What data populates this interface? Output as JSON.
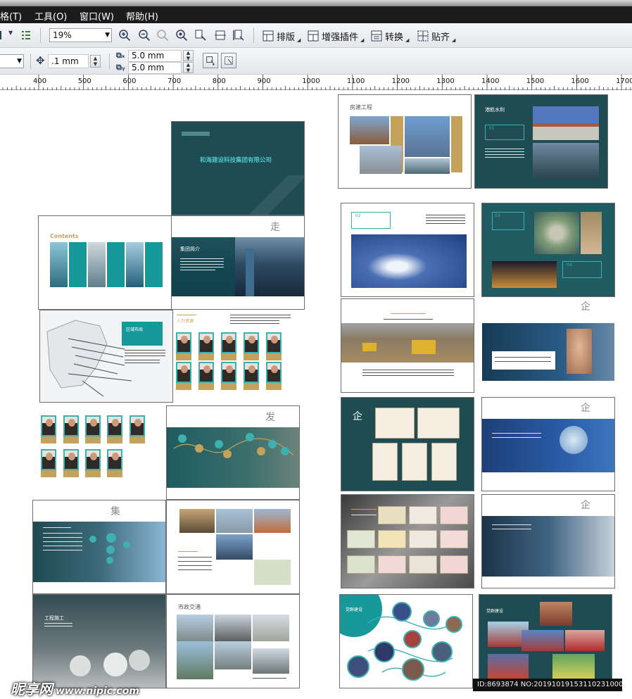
{
  "menubar": {
    "items": [
      "格(T)",
      "工具(O)",
      "窗口(W)",
      "帮助(H)"
    ]
  },
  "toolbar": {
    "zoom_value": "19%",
    "layout_label": "排版",
    "enhance_plugin_label": "增强插件",
    "convert_label": "转换",
    "snap_label": "贴齐"
  },
  "property_bar": {
    "nudge_value": ".1 mm",
    "duplicate_x": "5.0 mm",
    "duplicate_y": "5.0 mm"
  },
  "ruler": {
    "labels": [
      "400",
      "500",
      "600",
      "700",
      "800",
      "900",
      "1000",
      "1100",
      "1200",
      "1300",
      "1400",
      "1500",
      "1600",
      "1700"
    ]
  },
  "document": {
    "cover_company": "和海建设科技集团有限公司",
    "contents_title": "Contents",
    "section_group_intro": "集团简介",
    "section_hr": "人力资源",
    "section_engineering": "工程施工",
    "section_water": "港航水利",
    "section_housing": "房建工程",
    "section_regional": "区域布局",
    "section_transport": "市政交通",
    "section_party": "党群建设",
    "num_01": "01",
    "num_02": "02",
    "num_03": "03",
    "num_04": "04"
  },
  "watermark": {
    "site": "昵享网",
    "url": "www.nipic.com",
    "id": "ID:8693874 NO:20191019153110231000"
  },
  "colors": {
    "teal_dark": "#1f4b52",
    "teal": "#17777f",
    "gold": "#c4a25c",
    "menubar": "#1b1b1b"
  }
}
